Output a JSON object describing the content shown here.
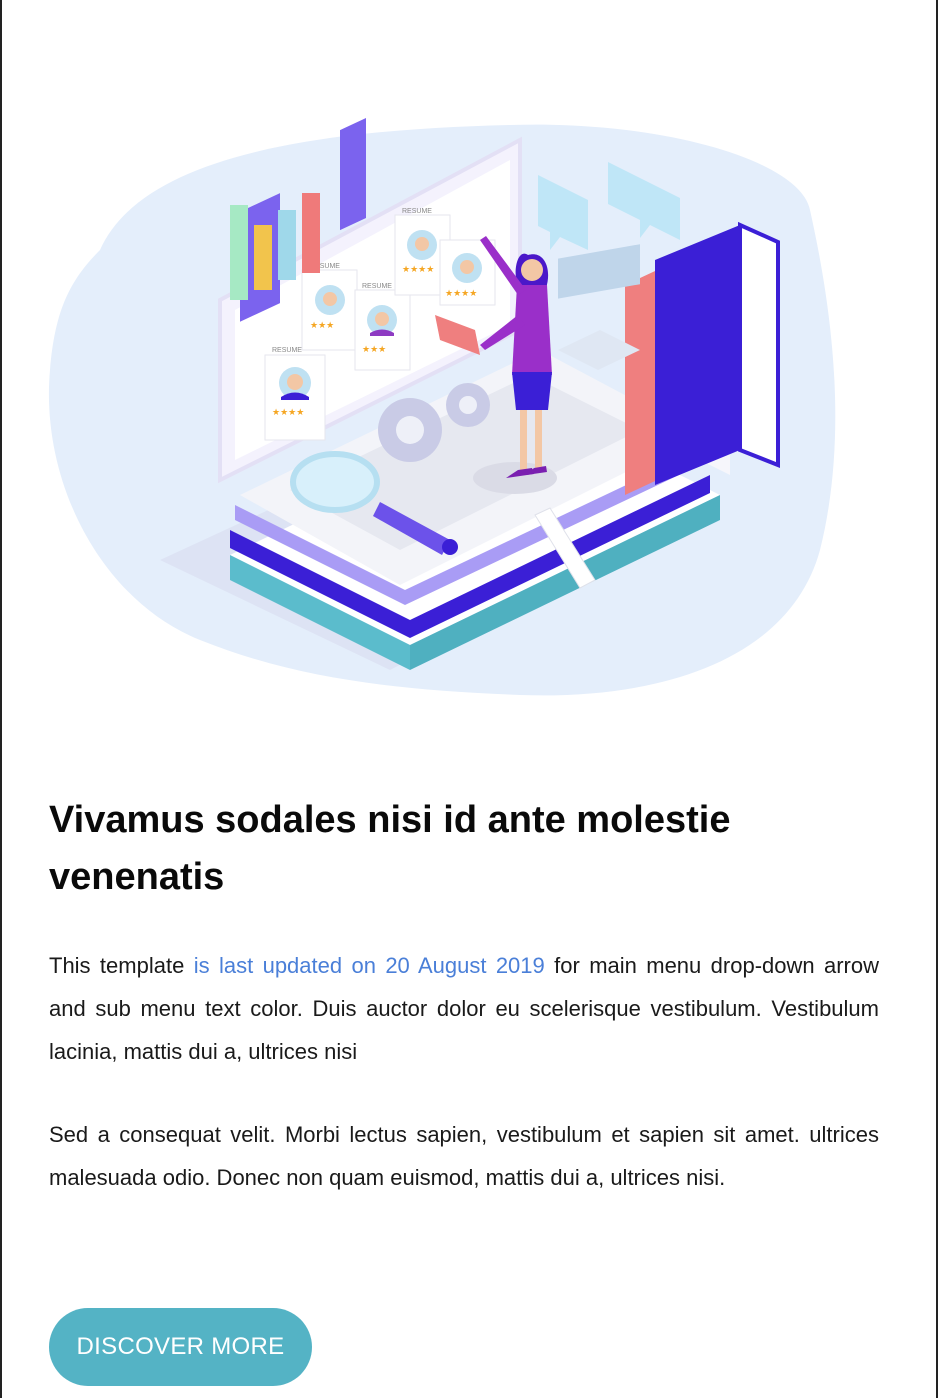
{
  "article": {
    "title": "Vivamus sodales nisi id ante molestie venenatis",
    "paragraph1": {
      "before": "This template ",
      "link": "is last updated on 20 August 2019",
      "after": " for main menu drop-down arrow and sub menu text color. Duis auctor dolor eu scelerisque vestibulum. Vestibulum lacinia, mattis dui a, ultrices nisi"
    },
    "paragraph2": "Sed a consequat velit. Morbi lectus sapien, vestibulum et sapien sit amet. ultrices malesuada odio. Donec non quam euismod, mattis dui a, ultrices nisi.",
    "cta_label": "DISCOVER MORE"
  },
  "illustration": {
    "resume_label": "RESUME"
  },
  "colors": {
    "link": "#4a7fd8",
    "button": "#54b3c5",
    "accent_purple": "#3b1fd6",
    "blob": "#e4eefb"
  }
}
